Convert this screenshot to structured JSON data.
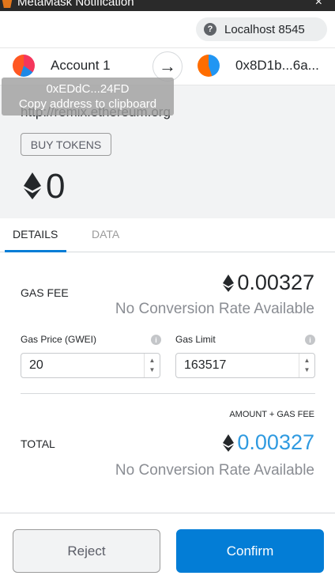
{
  "window": {
    "title": "MetaMask Notification",
    "close_glyph": "×"
  },
  "network": {
    "label": "Localhost 8545",
    "icon": "help-icon"
  },
  "accounts": {
    "from_name": "Account 1",
    "to_address": "0x8D1b...6a...",
    "arrow_glyph": "→",
    "tooltip_address": "0xEDdC...24FD",
    "tooltip_text": "Copy address to clipboard"
  },
  "summary": {
    "origin": "http://remix.ethereum.org",
    "buy_tokens_label": "BUY TOKENS",
    "amount": "0"
  },
  "tabs": [
    {
      "label": "DETAILS",
      "active": true
    },
    {
      "label": "DATA",
      "active": false
    }
  ],
  "details": {
    "gas_fee_label": "GAS FEE",
    "gas_fee_value": "0.00327",
    "no_conversion": "No Conversion Rate Available",
    "gas_price_label": "Gas Price (GWEI)",
    "gas_price_value": "20",
    "gas_limit_label": "Gas Limit",
    "gas_limit_value": "163517",
    "amount_gas_fee_label": "AMOUNT + GAS FEE",
    "total_label": "TOTAL",
    "total_value": "0.00327"
  },
  "actions": {
    "reject_label": "Reject",
    "confirm_label": "Confirm"
  },
  "colors": {
    "accent": "#037dd6",
    "total_text": "#2f9ae0",
    "summary_bg": "#f2f3f4"
  }
}
